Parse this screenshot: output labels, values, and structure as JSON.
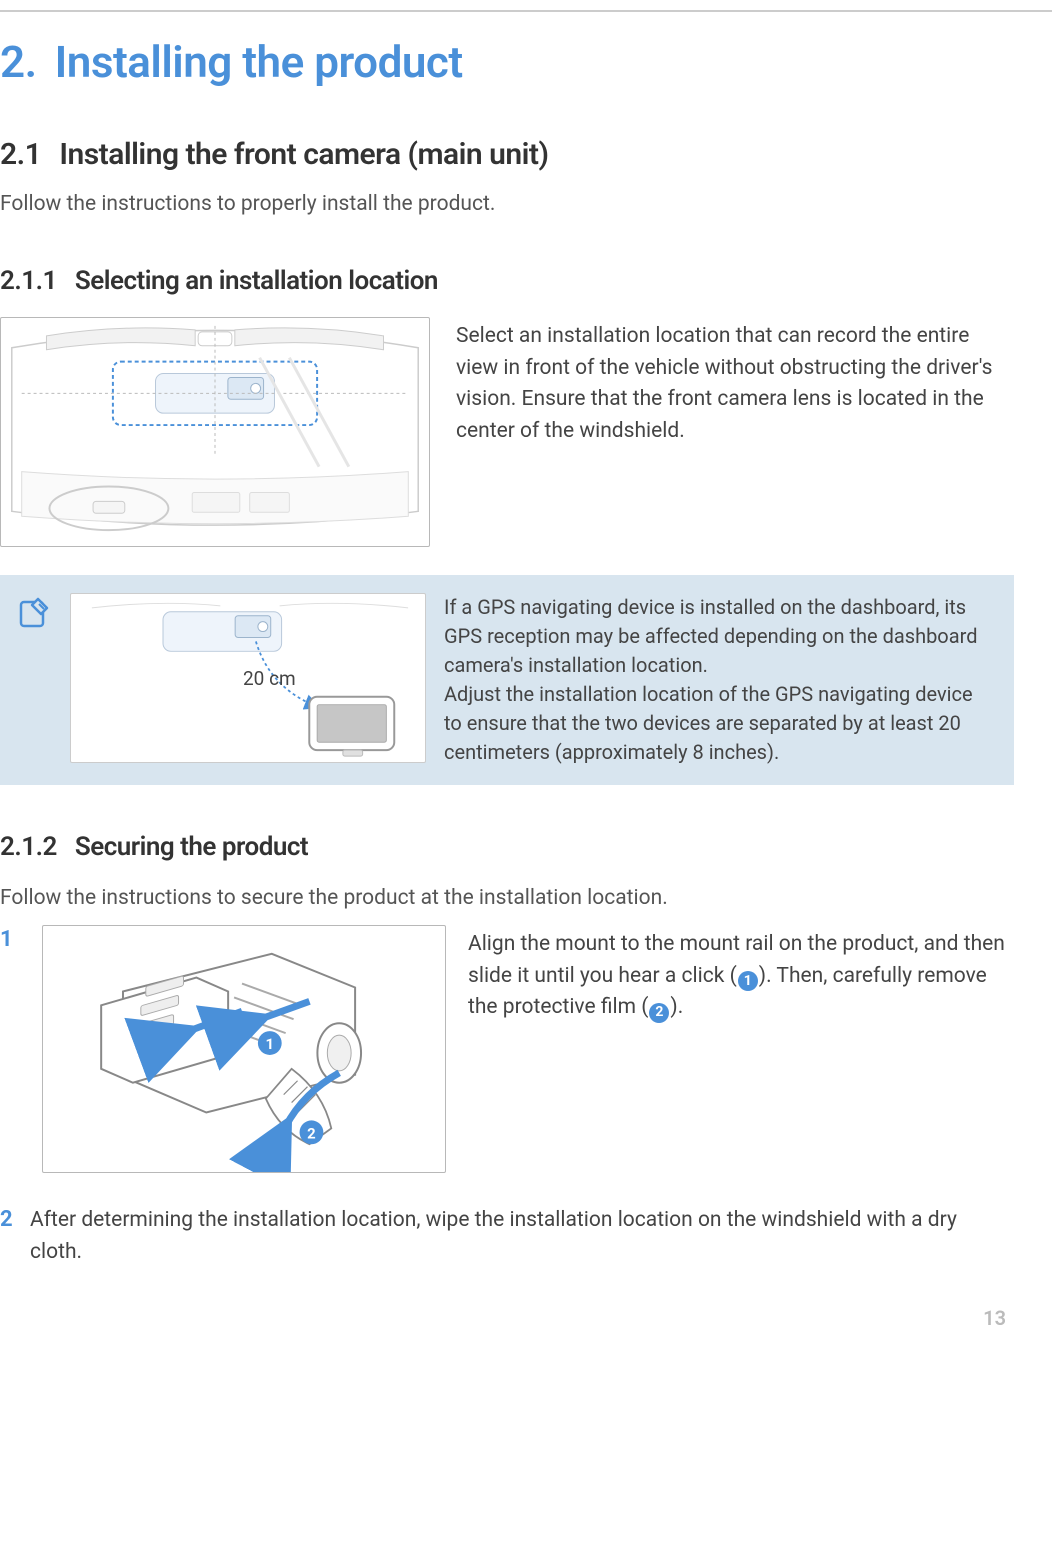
{
  "chapter": {
    "number": "2.",
    "title": "Installing the product"
  },
  "section_2_1": {
    "number": "2.1",
    "title": "Installing the front camera (main unit)",
    "intro": "Follow the instructions to properly install the product."
  },
  "sub_2_1_1": {
    "number": "2.1.1",
    "title": "Selecting an installation location",
    "body": "Select an installation location that can record the entire view in front of the vehicle without obstructing the driver's vision. Ensure that the front camera lens is located in the center of the windshield."
  },
  "note": {
    "distance_label": "20 cm",
    "body": "If a GPS navigating device is installed on the dashboard, its GPS reception may be affected depending on the dashboard camera's installation location.\nAdjust the installation location of the GPS navigating device to ensure that the two devices are separated by at least 20 centimeters (approximately 8 inches)."
  },
  "sub_2_1_2": {
    "number": "2.1.2",
    "title": "Securing the product",
    "intro": "Follow the instructions to secure the product at the installation location."
  },
  "step1": {
    "number": "1",
    "text_a": "Align the mount to the mount rail on the product, and then slide it until you hear a click (",
    "text_b": "). Then, carefully remove the protective film (",
    "text_c": ").",
    "callout1": "1",
    "callout2": "2"
  },
  "step2": {
    "number": "2",
    "body": "After determining the installation location, wipe the installation location on the windshield with a dry cloth."
  },
  "page_number": "13"
}
